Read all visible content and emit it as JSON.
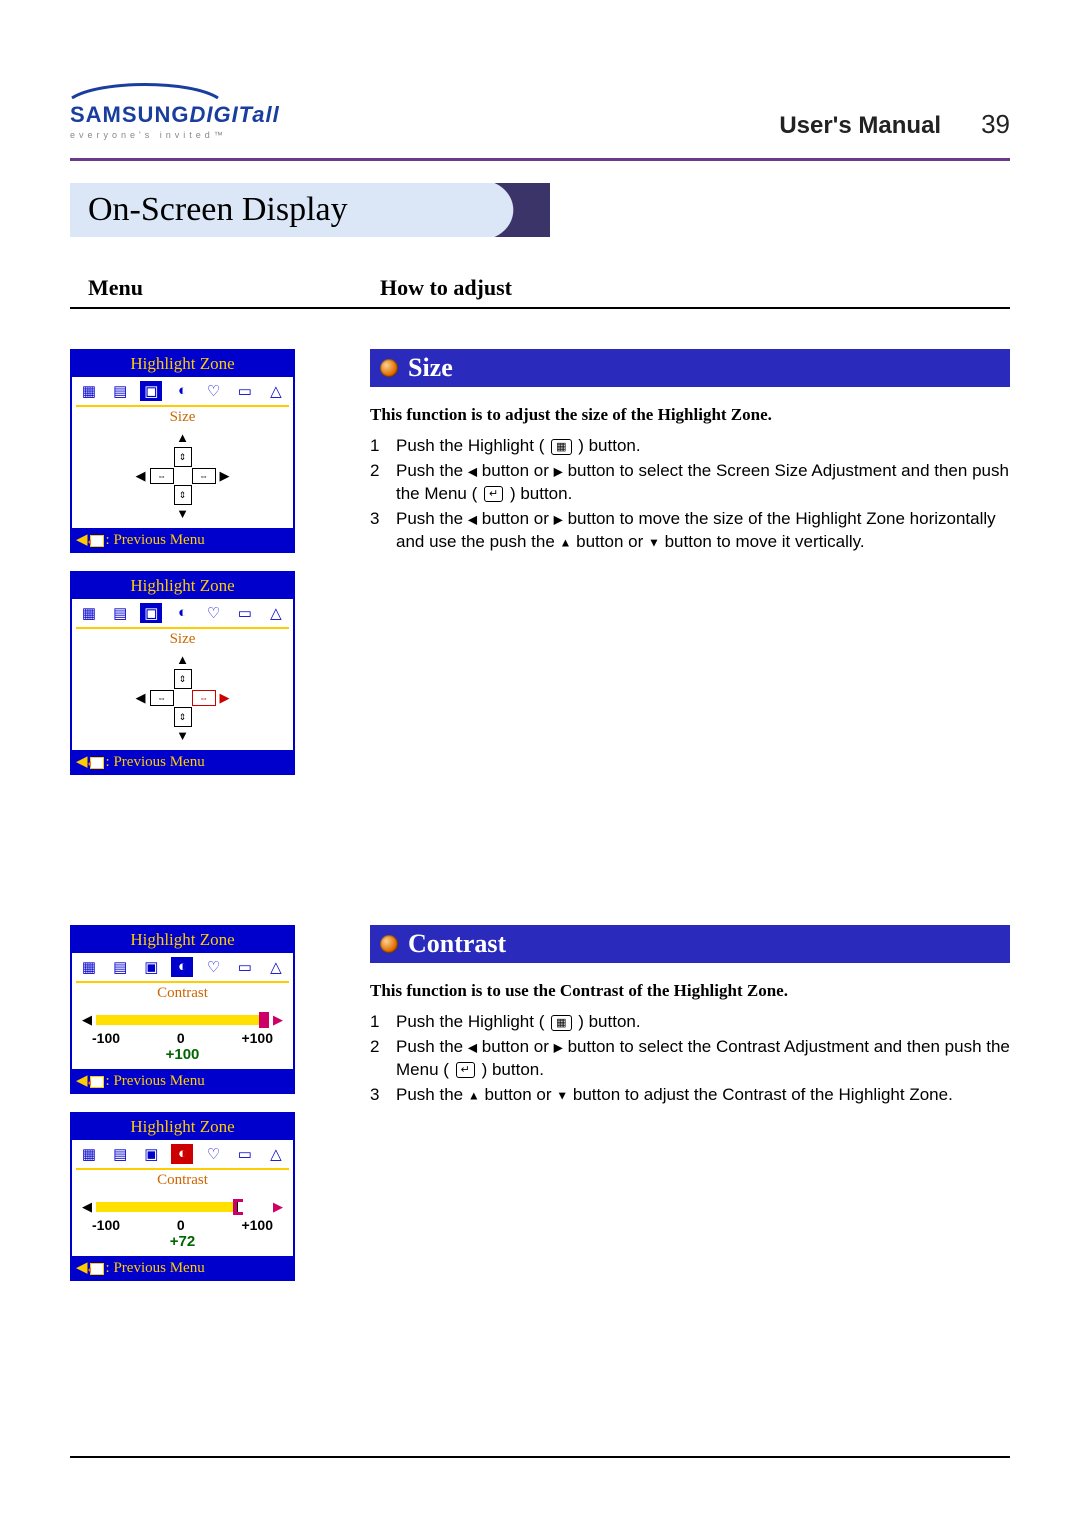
{
  "brand": {
    "name_plain": "SAMSUNG",
    "name_suffix": "DIGITall",
    "tagline": "everyone's invited™"
  },
  "header": {
    "manual_label": "User's Manual",
    "page_number": "39"
  },
  "section_title": "On-Screen Display",
  "subhead": {
    "menu": "Menu",
    "how": "How to adjust"
  },
  "osd_common": {
    "title": "Highlight Zone",
    "previous_menu_label": ": Previous Menu",
    "icon_row_count": 7
  },
  "size": {
    "osd_label": "Size",
    "topic_title": "Size",
    "description": "This function is to adjust the size of the Highlight Zone.",
    "steps": [
      "Push the Highlight ( [H] ) button.",
      "Push the ◀ button or ▶ button to select the Screen Size Adjustment and then push the Menu ( ↵ ) button.",
      "Push the ◀ button or ▶ button to move the size of the Highlight Zone horizontally and use the push the ▲ button or ▼ button to move it vertically."
    ],
    "panel_a_selected": "horizontal",
    "panel_b_selected": "horizontal-right"
  },
  "contrast": {
    "osd_label": "Contrast",
    "topic_title": "Contrast",
    "description": "This function is to use the Contrast of the Highlight Zone.",
    "steps": [
      "Push the Highlight ( [H] ) button.",
      "Push the ◀ button or ▶ button to select the Contrast Adjustment and then push the Menu ( ↵ ) button.",
      "Push the ▲ button or ▼ button to adjust the Contrast of the Highlight Zone."
    ],
    "scale_min": "-100",
    "scale_mid": "0",
    "scale_max": "+100",
    "panel_a_value": "+100",
    "panel_b_value": "+72"
  }
}
